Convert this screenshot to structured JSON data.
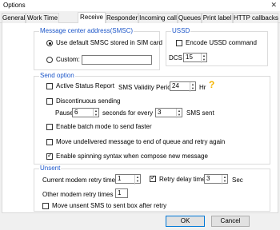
{
  "window": {
    "title": "Options"
  },
  "tabs": [
    "General",
    "Work Time",
    "Receive",
    "Responder",
    "Incoming call",
    "Queues",
    "Print label",
    "HTTP callbacks"
  ],
  "message_center": {
    "legend": "Message center address(SMSC)",
    "default_label": "Use default SMSC stored in SIM card",
    "custom_label": "Custom:",
    "custom_value": ""
  },
  "ussd": {
    "legend": "USSD",
    "encode_label": "Encode USSD command",
    "dcs_label": "DCS",
    "dcs_value": "15"
  },
  "send_option": {
    "legend": "Send option",
    "status_report_label": "Active Status Report",
    "validity_label": "SMS Validity Period",
    "validity_value": "24",
    "validity_unit": "Hr",
    "discontinuous_label": "Discontinuous sending",
    "pause_label": "Pause",
    "pause_value": "6",
    "seconds_label": "seconds for every",
    "every_value": "3",
    "sms_sent_label": "SMS sent",
    "batch_label": "Enable batch mode to send faster",
    "move_undelivered_label": "Move undelivered message to end of queue and retry again",
    "spinning_label": "Enable spinning syntax when compose new message"
  },
  "unsent": {
    "legend": "Unsent",
    "current_retry_label": "Current modem retry times",
    "current_retry_value": "1",
    "retry_delay_label": "Retry delay time",
    "retry_delay_value": "3",
    "retry_delay_unit": "Sec",
    "other_retry_label": "Other modem retry times",
    "other_retry_value": "1",
    "move_unsent_label": "Move unsent SMS to sent box after retry"
  },
  "buttons": {
    "ok": "OK",
    "cancel": "Cancel"
  },
  "icons": {
    "close": "close-icon",
    "help": "help-icon"
  },
  "colors": {
    "legend": "#1c56c9",
    "help": "#f4b400",
    "panel": "#ffffff",
    "window": "#f0f0f0"
  }
}
